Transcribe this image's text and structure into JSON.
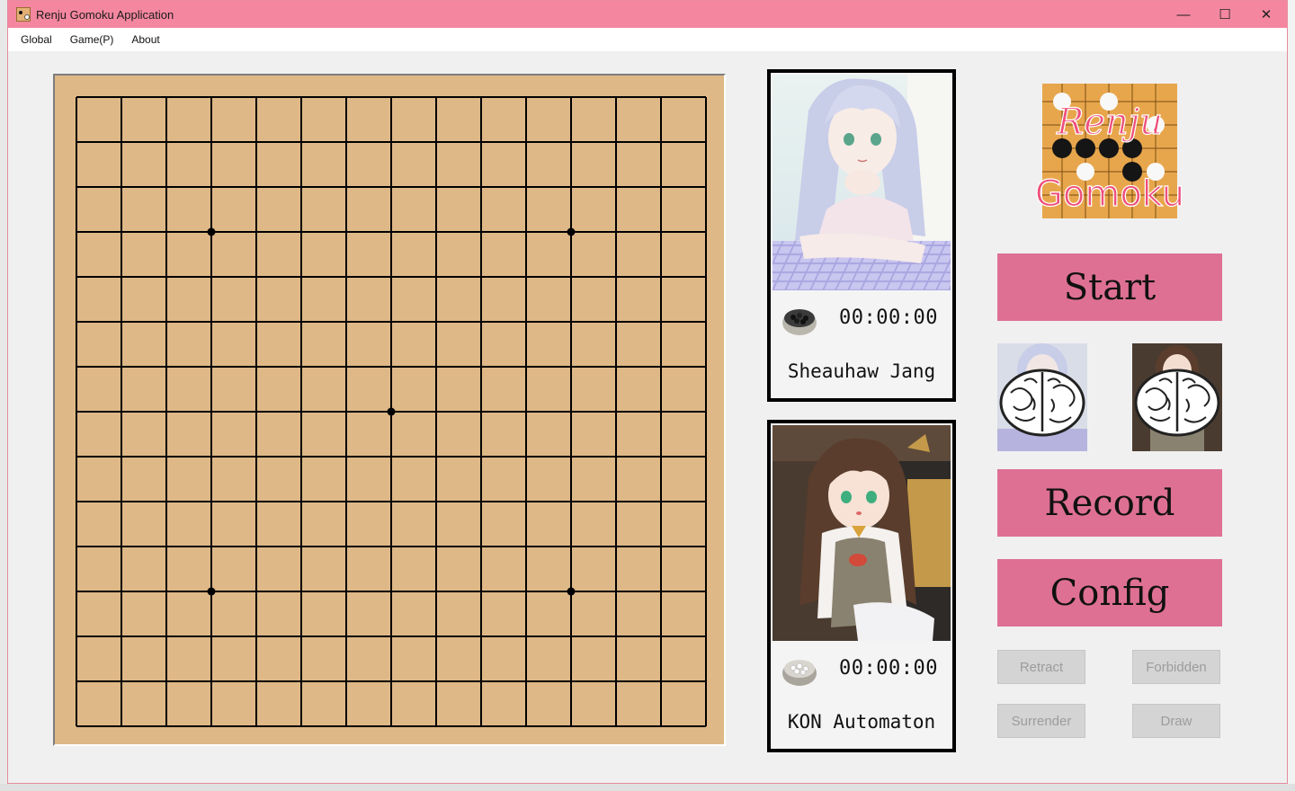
{
  "window": {
    "title": "Renju Gomoku Application",
    "minimize": "—",
    "maximize": "☐",
    "close": "✕"
  },
  "menu": [
    "Global",
    "Game(P)",
    "About"
  ],
  "board": {
    "size": 15,
    "star_points": [
      [
        3,
        3
      ],
      [
        11,
        3
      ],
      [
        7,
        7
      ],
      [
        3,
        11
      ],
      [
        11,
        11
      ]
    ]
  },
  "players": [
    {
      "name": "Sheauhaw Jang",
      "time": "00:00:00",
      "stone": "black"
    },
    {
      "name": "KON Automaton",
      "time": "00:00:00",
      "stone": "white"
    }
  ],
  "logo": {
    "line1": "Renju",
    "line2": "Gomoku"
  },
  "buttons": {
    "start": "Start",
    "record": "Record",
    "config": "Config"
  },
  "small_buttons": {
    "retract": "Retract",
    "forbidden": "Forbidden",
    "surrender": "Surrender",
    "draw": "Draw"
  },
  "colors": {
    "accent": "#de7094",
    "titlebar": "#f4879f",
    "board": "#deb887"
  }
}
